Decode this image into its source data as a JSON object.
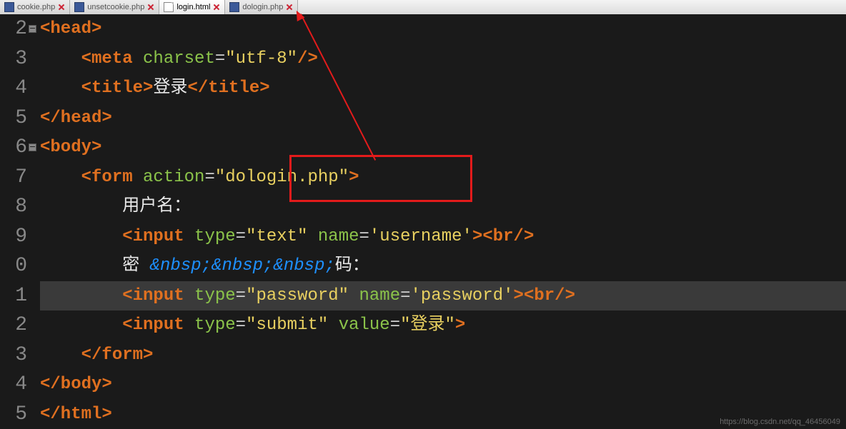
{
  "tabs": [
    {
      "label": "cookie.php",
      "type": "php",
      "active": false
    },
    {
      "label": "unsetcookie.php",
      "type": "php",
      "active": false
    },
    {
      "label": "login.html",
      "type": "html",
      "active": true
    },
    {
      "label": "dologin.php",
      "type": "php",
      "active": false
    }
  ],
  "gutter": [
    "2",
    "3",
    "4",
    "5",
    "6",
    "7",
    "8",
    "9",
    "0",
    "1",
    "2",
    "3",
    "4",
    "5"
  ],
  "code": {
    "l2": {
      "tag_o": "<head>",
      "indent": ""
    },
    "l3": {
      "indent": "    ",
      "tag_o": "<meta ",
      "attr1": "charset",
      "op1": "=",
      "val1": "\"utf-8\"",
      "tag_c": "/>"
    },
    "l4": {
      "indent": "    ",
      "tag_o": "<title>",
      "txt": "登录",
      "tag_c": "</title>"
    },
    "l5": {
      "tag_o": "</head>"
    },
    "l6": {
      "tag_o": "<body>"
    },
    "l7": {
      "indent": "    ",
      "tag_o": "<form ",
      "attr1": "action",
      "op1": "=",
      "val_q1": "\"",
      "val_inner": "dologin.php",
      "val_q2": "\"",
      "tag_c": ">"
    },
    "l8": {
      "indent": "        ",
      "txt": "用户名："
    },
    "l9": {
      "indent": "        ",
      "tag_o": "<input ",
      "attr1": "type",
      "op1": "=",
      "val1": "\"text\"",
      "sp1": " ",
      "attr2": "name",
      "op2": "=",
      "val2": "'username'",
      "tag_c": ">",
      "br": "<br/>"
    },
    "l10": {
      "indent": "        ",
      "txt1": "密 ",
      "ent": "&nbsp;&nbsp;&nbsp;",
      "txt2": "码："
    },
    "l11": {
      "indent": "        ",
      "tag_o": "<input ",
      "attr1": "type",
      "op1": "=",
      "val1": "\"password\"",
      "sp1": " ",
      "attr2": "name",
      "op2": "=",
      "val2": "'password'",
      "tag_c": ">",
      "br": "<br/>"
    },
    "l12": {
      "indent": "        ",
      "tag_o": "<input ",
      "attr1": "type",
      "op1": "=",
      "val1": "\"submit\"",
      "sp1": " ",
      "attr2": "value",
      "op2": "=",
      "val2": "\"登录\"",
      "tag_c": ">"
    },
    "l13": {
      "indent": "    ",
      "tag_o": "</form>"
    },
    "l14": {
      "tag_o": "</body>"
    },
    "l15": {
      "tag_o": "</html>"
    }
  },
  "annotation": {
    "target": "dologin.php"
  },
  "watermark": "https://blog.csdn.net/qq_46456049"
}
